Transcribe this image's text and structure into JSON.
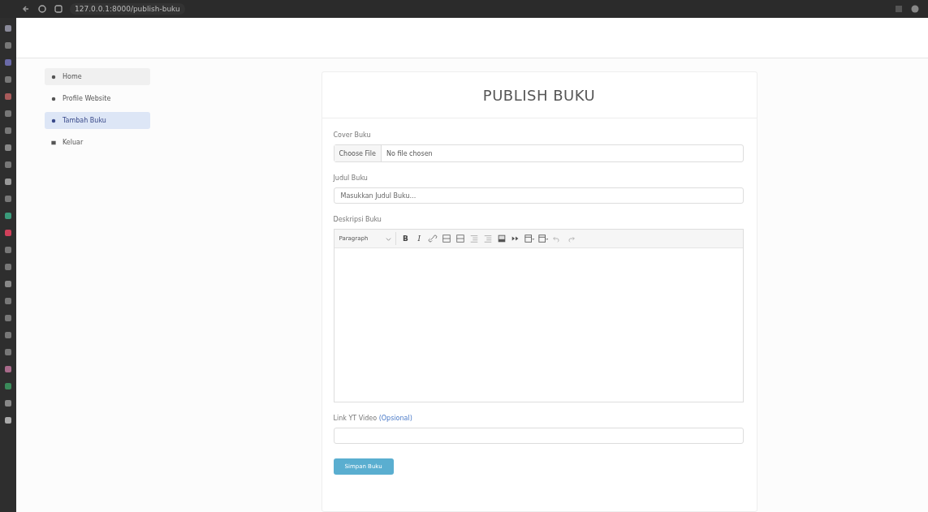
{
  "browser": {
    "url": "127.0.0.1:8000/publish-buku"
  },
  "sidebar": {
    "items": [
      {
        "label": "Home",
        "selected": false,
        "kind": "dot"
      },
      {
        "label": "Profile Website",
        "selected": false,
        "kind": "dot"
      },
      {
        "label": "Tambah Buku",
        "selected": true,
        "kind": "dot"
      },
      {
        "label": "Keluar",
        "selected": false,
        "kind": "book"
      }
    ]
  },
  "form": {
    "title": "PUBLISH BUKU",
    "cover": {
      "label": "Cover Buku",
      "button": "Choose File",
      "status": "No file chosen"
    },
    "judul": {
      "label": "Judul Buku",
      "placeholder": "Masukkan Judul Buku..."
    },
    "deskripsi": {
      "label": "Deskripsi Buku",
      "format": "Paragraph",
      "bold": "B",
      "italic": "I"
    },
    "video": {
      "label": "Link YT Video",
      "note": "(Opsional)"
    },
    "submit": "Simpan Buku"
  }
}
